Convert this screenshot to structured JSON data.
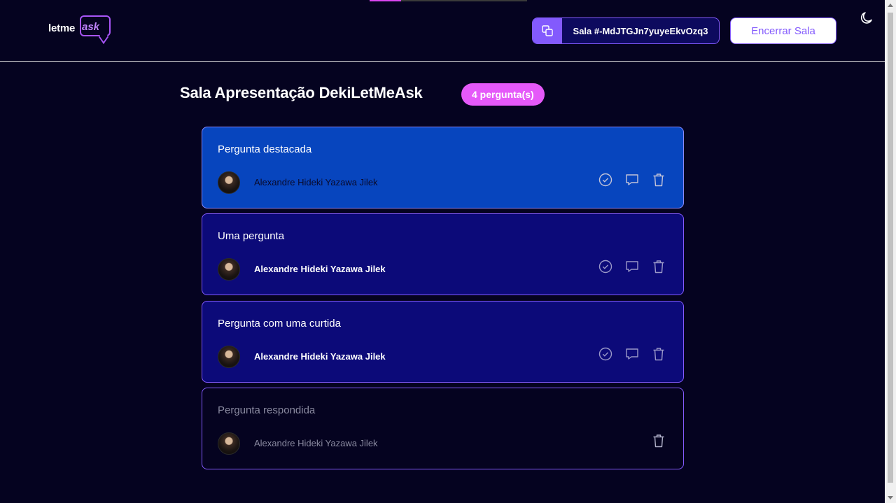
{
  "header": {
    "logo": {
      "text_left": "letme",
      "text_right": "ask"
    },
    "room_code": {
      "label": "Sala #-MdJTGJn7yuyeEkvOzq3"
    },
    "close_room_button": "Encerrar Sala",
    "theme_toggle_icon": "moon-icon"
  },
  "room": {
    "title": "Sala Apresentação DekiLetMeAsk",
    "count_badge": "4 pergunta(s)"
  },
  "questions": [
    {
      "text": "Pergunta destacada",
      "author": "Alexandre Hideki Yazawa Jilek",
      "state": "highlighted",
      "actions": [
        "check-icon",
        "comment-icon",
        "trash-icon"
      ]
    },
    {
      "text": "Uma pergunta",
      "author": "Alexandre Hideki Yazawa Jilek",
      "state": "normal",
      "actions": [
        "check-icon",
        "comment-icon",
        "trash-icon"
      ]
    },
    {
      "text": "Pergunta com uma curtida",
      "author": "Alexandre Hideki Yazawa Jilek",
      "state": "normal",
      "actions": [
        "check-icon",
        "comment-icon",
        "trash-icon"
      ]
    },
    {
      "text": "Pergunta respondida",
      "author": "Alexandre Hideki Yazawa Jilek",
      "state": "answered",
      "actions": [
        "trash-icon"
      ]
    }
  ],
  "colors": {
    "background": "#050320",
    "accent": "#835afd",
    "badge": "#e559f9",
    "highlighted_card": "#0745be",
    "normal_card": "#0c0a79"
  }
}
